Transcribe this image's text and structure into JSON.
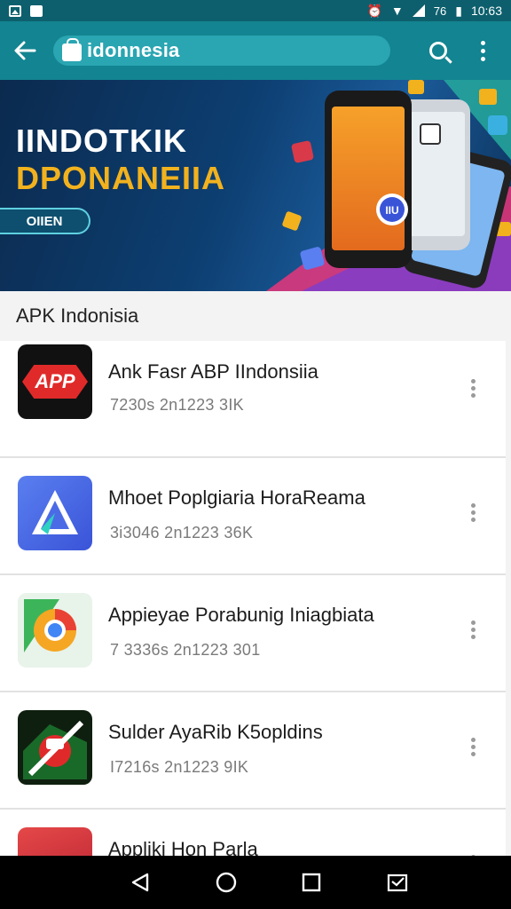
{
  "status_bar": {
    "battery": "76",
    "time": "10:63"
  },
  "app_bar": {
    "title": "idonnesia"
  },
  "banner": {
    "line1": "IINDOTKIK",
    "line2": "DPONANEIIA",
    "button_label": "OIIEN",
    "phone_badge": "IIU"
  },
  "section": {
    "title": "APK Indonisia"
  },
  "apps": [
    {
      "title": "Ank Fasr ABP IIndonsiia",
      "meta": "7230s  2n1223 3IK",
      "icon_text": "APP",
      "icon": "app-badge-icon"
    },
    {
      "title": "Mhoet Poplgiaria HoraReama",
      "meta": "3i3046  2n1223 36K",
      "icon": "triangle-logo-icon"
    },
    {
      "title": "Appieyae Porabunig Iniagbiata",
      "meta": "7 3336s  2n1223 301",
      "icon": "browser-ring-icon"
    },
    {
      "title": "Sulder AyaRib K5opldins",
      "meta": "I7216s  2n1223 9IK",
      "icon": "crossed-out-icon"
    },
    {
      "title": "Appliki Hon Parla",
      "meta": "",
      "icon": "red-app-icon"
    }
  ],
  "colors": {
    "app_bar": "#138491",
    "status_bar": "#0d5f6d",
    "accent_yellow": "#f2b21e"
  }
}
